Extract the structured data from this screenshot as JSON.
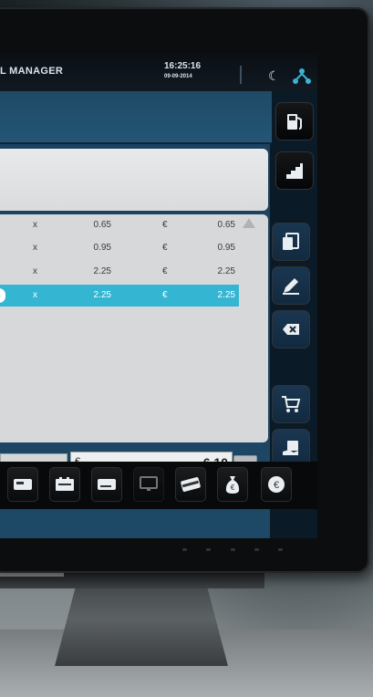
{
  "app": {
    "title": "L MANAGER"
  },
  "clock": {
    "time": "16:25:16",
    "date": "09-09-2014"
  },
  "icons": {
    "night_mode": "moon-icon",
    "network": "network-icon",
    "side": [
      "fuel-pump-icon",
      "stairs-icon",
      "copy-document-icon",
      "pencil-icon",
      "delete-key-icon",
      "shopping-cart-icon",
      "bag-hand-icon"
    ],
    "toolbar": [
      "card-icon-1",
      "cash-drawer-icon",
      "card-icon-2",
      "monitor-icon",
      "payment-card-icon",
      "money-bag-icon",
      "euro-coin-icon"
    ]
  },
  "order_lines": [
    {
      "qty_marker": "x",
      "unit_price": "0.65",
      "currency": "€",
      "total": "0.65",
      "selected": false
    },
    {
      "qty_marker": "x",
      "unit_price": "0.95",
      "currency": "€",
      "total": "0.95",
      "selected": false
    },
    {
      "qty_marker": "x",
      "unit_price": "2.25",
      "currency": "€",
      "total": "2.25",
      "selected": false
    },
    {
      "qty_marker": "x",
      "unit_price": "2.25",
      "currency": "€",
      "total": "2.25",
      "selected": true
    }
  ],
  "summary": {
    "currency": "€",
    "total": "6.10"
  },
  "colors": {
    "accent": "#34b6d3",
    "header": "#245676",
    "panel": "#d6d8d9"
  }
}
